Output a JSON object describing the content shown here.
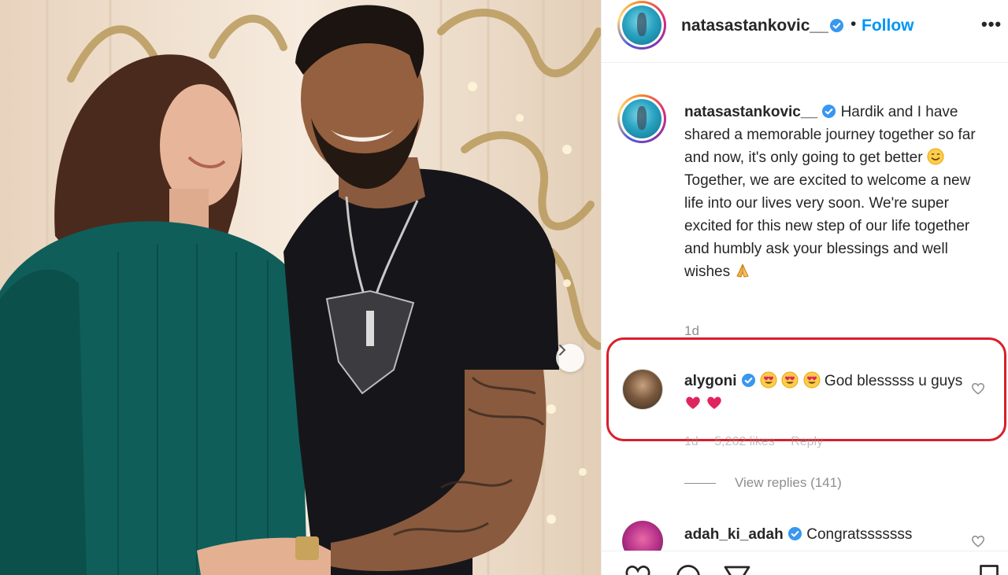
{
  "post": {
    "username": "natasastankovic__",
    "follow_label": "Follow",
    "separator": "•",
    "more_label": "•••",
    "caption": {
      "username": "natasastankovic__",
      "text_part1": "Hardik and I have shared a memorable journey together so far and now, it's only going to get better",
      "text_part2": "Together, we are excited to welcome a new life into our lives very soon. We're super excited for this new step of our life together and humbly ask your blessings and well wishes",
      "time": "1d"
    }
  },
  "comments": [
    {
      "username": "alygoni",
      "text": "God blesssss u guys",
      "meta_time": "1d",
      "meta_likes": "5,262 likes",
      "meta_reply": "Reply",
      "view_replies": "View replies (141)"
    },
    {
      "username": "adah_ki_adah",
      "text": "Congratsssssss"
    }
  ],
  "colors": {
    "accent": "#0095f6",
    "highlight": "#d81f2b",
    "verified": "#3897f0",
    "heart": "#e0245e"
  }
}
